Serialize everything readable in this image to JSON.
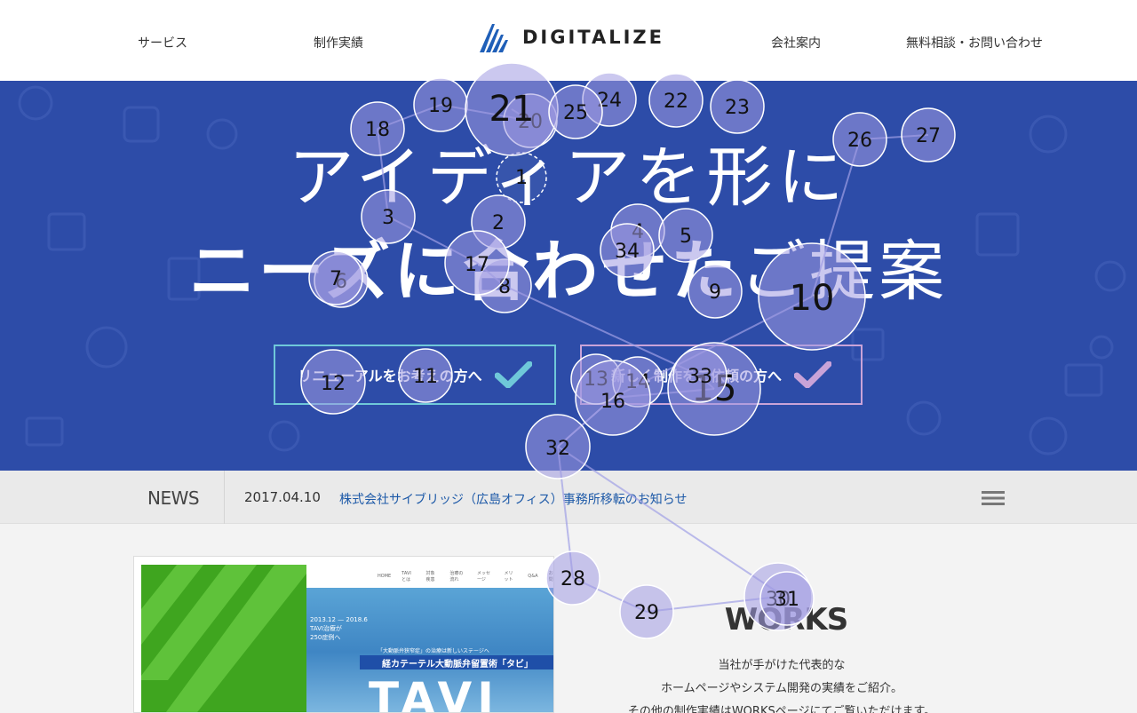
{
  "header": {
    "nav_left": [
      "サービス",
      "制作実績"
    ],
    "logo_text": "DIGITALIZE",
    "nav_right": [
      "会社案内",
      "無料相談・お問い合わせ"
    ]
  },
  "hero": {
    "title_line1": "アイディアを形に",
    "title_line2_bold": "ニーズに合わせた",
    "title_line2_light": "ご提案",
    "cta_renewal": "リニューアルをお考えの方へ",
    "cta_new": "新しく制作をご依頼の方へ",
    "colors": {
      "background": "#2d4ca8",
      "renewal_accent": "#6fc8d9",
      "new_accent": "#c9a3d8"
    }
  },
  "news": {
    "label": "NEWS",
    "date": "2017.04.10",
    "headline": "株式会社サイブリッジ（広島オフィス）事務所移転のお知らせ",
    "menu_icon": "hamburger-icon"
  },
  "works": {
    "title": "WORKS",
    "desc": [
      "当社が手がけた代表的な",
      "ホームページやシステム開発の実績をご紹介。",
      "その他の制作実績はWORKSページにてご覧いただけます。"
    ],
    "thumb": {
      "nav": [
        "HOME",
        "TAVIとは",
        "対象疾患",
        "治療の流れ",
        "メッセージ",
        "メリット",
        "Q&A",
        "お問"
      ],
      "small": [
        "2013.12 — 2018.6",
        "TAVI治療が",
        "250症例へ"
      ],
      "tagline": "「大動脈弁狭窄症」の治療は新しいステージへ",
      "banner": "経カテーテル大動脈弁留置術「タビ」",
      "big": "TAVI"
    }
  },
  "overlay": {
    "markers": [
      "1",
      "2",
      "3",
      "4",
      "5",
      "6",
      "7",
      "8",
      "9",
      "10",
      "11",
      "12",
      "13",
      "14",
      "15",
      "16",
      "17",
      "18",
      "19",
      "20",
      "21",
      "22",
      "23",
      "24",
      "25",
      "26",
      "27",
      "28",
      "29",
      "30",
      "31",
      "32",
      "33",
      "34"
    ]
  }
}
